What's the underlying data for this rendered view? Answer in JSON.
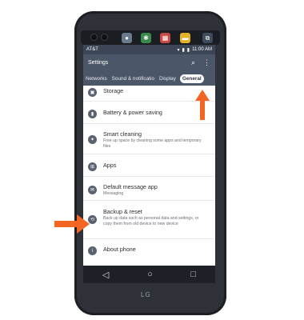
{
  "status_bar": {
    "carrier": "AT&T",
    "time": "11:00 AM"
  },
  "app_bar": {
    "title": "Settings",
    "search_icon": "search-icon",
    "menu_icon": "more-vert-icon"
  },
  "tabs": [
    {
      "label": "Networks"
    },
    {
      "label": "Sound & notificatio"
    },
    {
      "label": "Display"
    },
    {
      "label": "General"
    }
  ],
  "settings": [
    {
      "title": "Storage",
      "subtitle": ""
    },
    {
      "title": "Battery & power saving",
      "subtitle": ""
    },
    {
      "title": "Smart cleaning",
      "subtitle": "Free up space by cleaning some apps and temporary files"
    },
    {
      "title": "Apps",
      "subtitle": ""
    },
    {
      "title": "Default message app",
      "subtitle": "Messaging"
    },
    {
      "title": "Backup & reset",
      "subtitle": "Back up data such as personal data and settings, or copy them from old device to new device"
    },
    {
      "title": "About phone",
      "subtitle": ""
    }
  ],
  "nav": {
    "back": "◁",
    "home": "○",
    "recents": "□"
  },
  "brand": "LG",
  "colors": {
    "arrow": "#f26522",
    "appbar": "#4b5669",
    "statusbar": "#3d4656"
  }
}
